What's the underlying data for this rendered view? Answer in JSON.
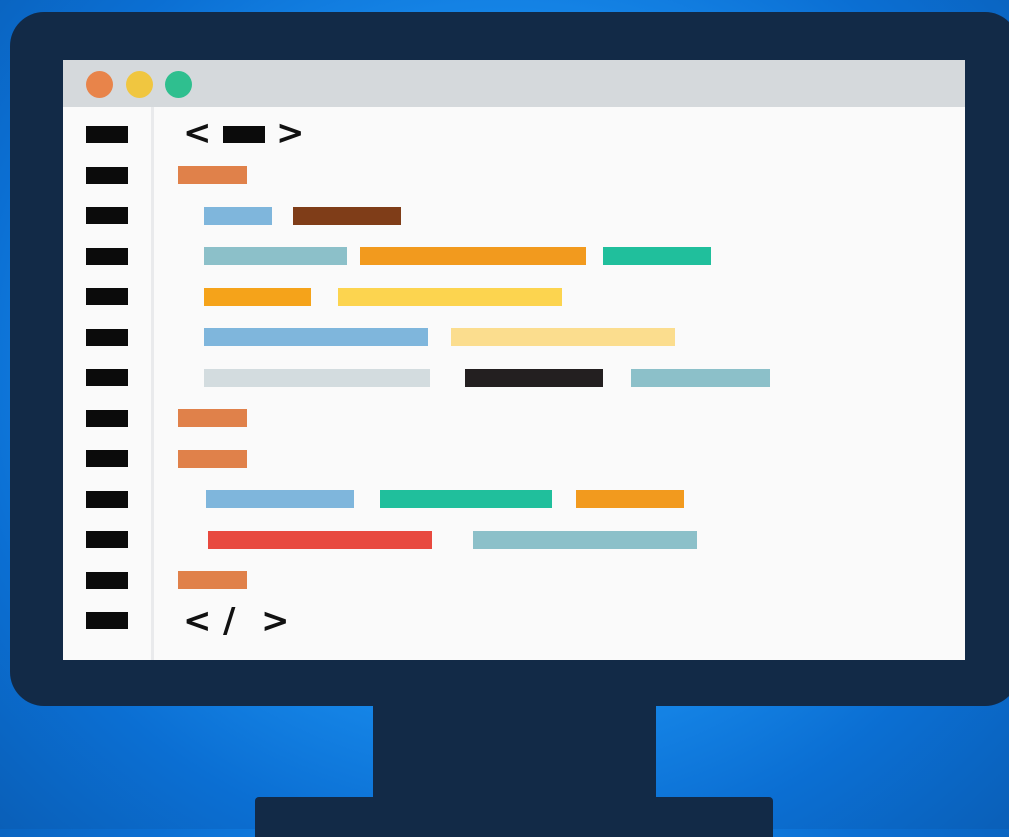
{
  "colors": {
    "frame": "#122a47",
    "titlebar": "#d5d9dc",
    "editor_bg": "#fafafa",
    "dot_close": "#e8844a",
    "dot_minimize": "#f0c640",
    "dot_maximize": "#2fbf8f"
  },
  "editor": {
    "open_left": "<",
    "open_right": ">",
    "close_left": "<",
    "close_slash": "/",
    "close_right": ">"
  },
  "line_numbers_count": 13
}
